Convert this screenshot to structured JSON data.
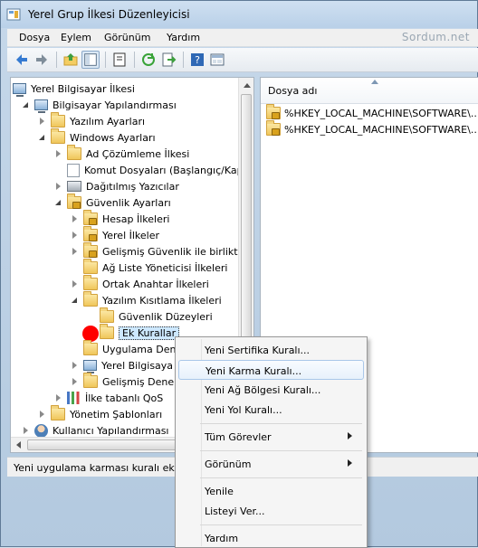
{
  "window": {
    "title": "Yerel Grup İlkesi Düzenleyicisi"
  },
  "menu": [
    "Dosya",
    "Eylem",
    "Görünüm",
    "Yardım"
  ],
  "watermark": "Sordum.net",
  "toolbar_buttons": [
    "back-icon",
    "forward-icon",
    "up-folder-icon",
    "show-hide-tree-icon",
    "properties-icon",
    "refresh-icon",
    "export-list-icon",
    "help-icon",
    "view-icon"
  ],
  "tree": [
    {
      "label": "Yerel Bilgisayar İlkesi",
      "icon": "computer-icon"
    },
    {
      "label": "Bilgisayar Yapılandırması",
      "icon": "computer-icon"
    },
    {
      "label": "Yazılım Ayarları",
      "icon": "folder-icon"
    },
    {
      "label": "Windows Ayarları",
      "icon": "folder-icon"
    },
    {
      "label": "Ad Çözümleme İlkesi",
      "icon": "folder-icon"
    },
    {
      "label": "Komut Dosyaları (Başlangıç/Kap",
      "icon": "document-icon"
    },
    {
      "label": "Dağıtılmış Yazıcılar",
      "icon": "printer-icon"
    },
    {
      "label": "Güvenlik Ayarları",
      "icon": "lock-folder-icon"
    },
    {
      "label": "Hesap İlkeleri",
      "icon": "lock-folder-icon"
    },
    {
      "label": "Yerel İlkeler",
      "icon": "lock-folder-icon"
    },
    {
      "label": "Gelişmiş Güvenlik ile birlikte",
      "icon": "lock-folder-icon"
    },
    {
      "label": "Ağ Liste Yöneticisi İlkeleri",
      "icon": "folder-icon"
    },
    {
      "label": "Ortak Anahtar İlkeleri",
      "icon": "folder-icon"
    },
    {
      "label": "Yazılım Kısıtlama İlkeleri",
      "icon": "folder-icon"
    },
    {
      "label": "Güvenlik Düzeyleri",
      "icon": "folder-icon"
    },
    {
      "label": "Ek Kurallar",
      "icon": "folder-icon"
    },
    {
      "label": "Uygulama Dene",
      "icon": "folder-icon"
    },
    {
      "label": "Yerel Bilgisaya",
      "icon": "computer-icon"
    },
    {
      "label": "Gelişmiş Dene",
      "icon": "folder-icon"
    },
    {
      "label": "İlke tabanlı QoS",
      "icon": "chart-icon"
    },
    {
      "label": "Yönetim Şablonları",
      "icon": "folder-icon"
    },
    {
      "label": "Kullanıcı Yapılandırması",
      "icon": "user-icon"
    }
  ],
  "list": {
    "column": "Dosya adı",
    "items": [
      "%HKEY_LOCAL_MACHINE\\SOFTWARE\\...",
      "%HKEY_LOCAL_MACHINE\\SOFTWARE\\..."
    ]
  },
  "status": "Yeni uygulama karması kuralı ekle",
  "context_menu": [
    "Yeni Sertifika Kuralı...",
    "Yeni Karma Kuralı...",
    "Yeni Ağ Bölgesi Kuralı...",
    "Yeni Yol Kuralı...",
    "Tüm Görevler",
    "Görünüm",
    "Yenile",
    "Listeyi Ver...",
    "Yardım"
  ],
  "colors": {
    "highlight": "#cde8ff",
    "marker": "#ff0000"
  }
}
